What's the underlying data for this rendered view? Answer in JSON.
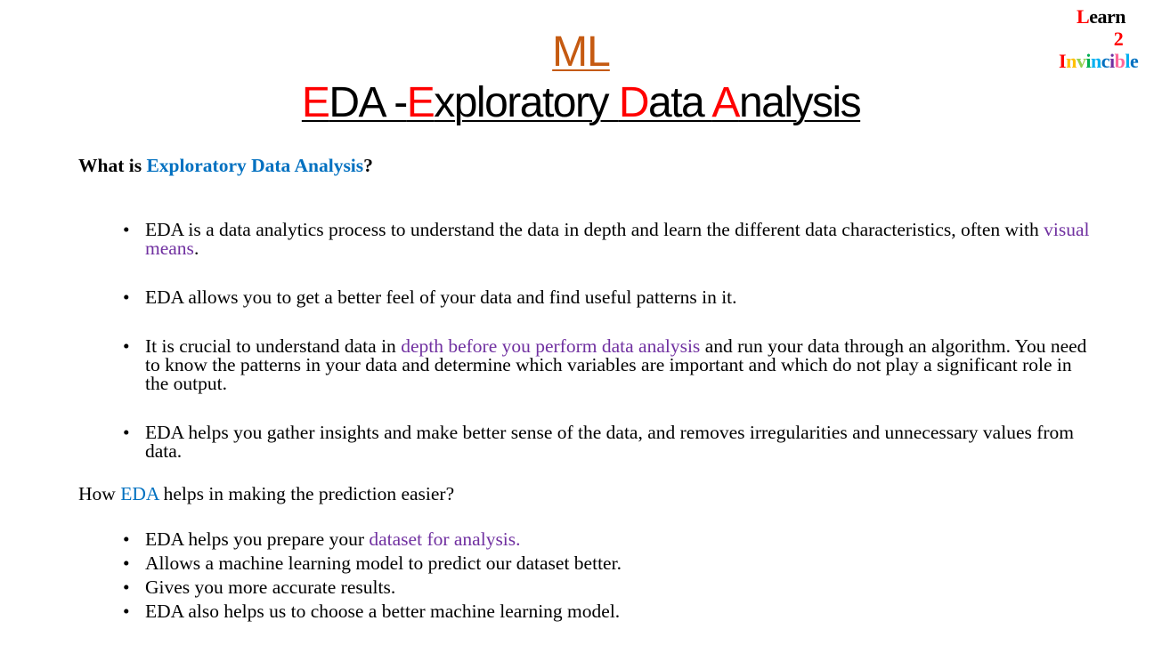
{
  "logo": {
    "line1": [
      {
        "t": "L",
        "c": "#ff0000"
      },
      {
        "t": "earn",
        "c": "#000000"
      }
    ],
    "line2": [
      {
        "t": "2",
        "c": "#ff0000"
      }
    ],
    "line3": [
      {
        "t": "I",
        "c": "#ff0000"
      },
      {
        "t": "n",
        "c": "#ffc000"
      },
      {
        "t": "v",
        "c": "#92d050"
      },
      {
        "t": "i",
        "c": "#00b050"
      },
      {
        "t": "n",
        "c": "#00b0f0"
      },
      {
        "t": "c",
        "c": "#0070c0"
      },
      {
        "t": "i",
        "c": "#7030a0"
      },
      {
        "t": "b",
        "c": "#ff6699"
      },
      {
        "t": "l",
        "c": "#00b0f0"
      },
      {
        "t": "e",
        "c": "#0070c0"
      }
    ]
  },
  "title": {
    "subject": "ML",
    "main_parts": [
      {
        "t": "E",
        "accent": true
      },
      {
        "t": "DA -",
        "accent": false
      },
      {
        "t": "E",
        "accent": true
      },
      {
        "t": "xploratory ",
        "accent": false
      },
      {
        "t": "D",
        "accent": true
      },
      {
        "t": "ata ",
        "accent": false
      },
      {
        "t": "A",
        "accent": true
      },
      {
        "t": "nalysis",
        "accent": false
      }
    ]
  },
  "section1": {
    "heading_pre": "What is ",
    "heading_highlight": "Exploratory Data Analysis",
    "heading_post": "?",
    "bullets": [
      {
        "parts": [
          {
            "t": "EDA is a data analytics process to understand the data in depth and learn the different data characteristics, often with ",
            "c": "text"
          },
          {
            "t": "visual means",
            "c": "purple"
          },
          {
            "t": ".",
            "c": "text"
          }
        ]
      },
      {
        "parts": [
          {
            "t": "EDA allows you to get a better feel of your data and find useful patterns in it.",
            "c": "text"
          }
        ]
      },
      {
        "parts": [
          {
            "t": "It is crucial to understand data in ",
            "c": "text"
          },
          {
            "t": "depth before you perform data analysis ",
            "c": "purple"
          },
          {
            "t": "and run your data through an algorithm. You need to know the patterns in your data and determine which variables are important and which do not play a significant role in the output.",
            "c": "text"
          }
        ]
      },
      {
        "parts": [
          {
            "t": "EDA helps you gather insights and make better sense of the data, and removes irregularities and unnecessary values from data.",
            "c": "text"
          }
        ]
      }
    ]
  },
  "section2": {
    "heading_pre": "How ",
    "heading_highlight": "EDA",
    "heading_post": " helps in making the prediction easier?",
    "bullets": [
      {
        "parts": [
          {
            "t": "EDA helps you prepare your ",
            "c": "text"
          },
          {
            "t": "dataset for analysis.",
            "c": "purple"
          }
        ]
      },
      {
        "parts": [
          {
            "t": "Allows a machine learning model to predict our dataset better.",
            "c": "text"
          }
        ]
      },
      {
        "parts": [
          {
            "t": "Gives you more accurate results.",
            "c": "text"
          }
        ]
      },
      {
        "parts": [
          {
            "t": "EDA also helps us to choose a better machine learning model.",
            "c": "text"
          }
        ]
      }
    ]
  },
  "colors": {
    "subject": "#c55a11",
    "accent": "#ff0000",
    "highlight_blue": "#0070c0",
    "highlight_purple": "#7030a0",
    "text": "#000000"
  }
}
